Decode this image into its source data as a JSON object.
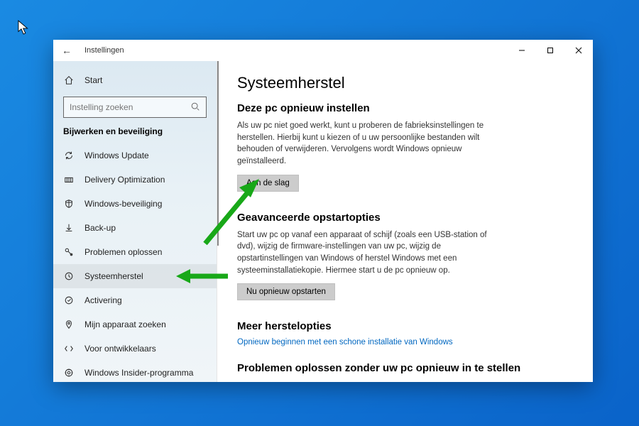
{
  "window": {
    "title": "Instellingen",
    "buttons": {
      "min": "–",
      "max": "□",
      "close": "✕"
    }
  },
  "sidebar": {
    "home": "Start",
    "search_placeholder": "Instelling zoeken",
    "heading": "Bijwerken en beveiliging",
    "items": [
      {
        "label": "Windows Update",
        "icon": "sync"
      },
      {
        "label": "Delivery Optimization",
        "icon": "delivery"
      },
      {
        "label": "Windows-beveiliging",
        "icon": "shield"
      },
      {
        "label": "Back-up",
        "icon": "backup"
      },
      {
        "label": "Problemen oplossen",
        "icon": "troubleshoot"
      },
      {
        "label": "Systeemherstel",
        "icon": "recovery",
        "selected": true
      },
      {
        "label": "Activering",
        "icon": "activation"
      },
      {
        "label": "Mijn apparaat zoeken",
        "icon": "find"
      },
      {
        "label": "Voor ontwikkelaars",
        "icon": "dev"
      },
      {
        "label": "Windows Insider-programma",
        "icon": "insider"
      }
    ]
  },
  "main": {
    "title": "Systeemherstel",
    "sections": [
      {
        "heading": "Deze pc opnieuw instellen",
        "body": "Als uw pc niet goed werkt, kunt u proberen de fabrieksinstellingen te herstellen. Hierbij kunt u kiezen of u uw persoonlijke bestanden wilt behouden of verwijderen. Vervolgens wordt Windows opnieuw geïnstalleerd.",
        "button": "Aan de slag"
      },
      {
        "heading": "Geavanceerde opstartopties",
        "body": "Start uw pc op vanaf een apparaat of schijf (zoals een USB-station of dvd), wijzig de firmware-instellingen van uw pc, wijzig de opstartinstellingen van Windows of herstel Windows met een systeeminstallatiekopie. Hiermee start u de pc opnieuw op.",
        "button": "Nu opnieuw opstarten"
      },
      {
        "heading": "Meer herstelopties",
        "link": "Opnieuw beginnen met een schone installatie van Windows"
      },
      {
        "heading": "Problemen oplossen zonder uw pc opnieuw in te stellen"
      }
    ]
  }
}
